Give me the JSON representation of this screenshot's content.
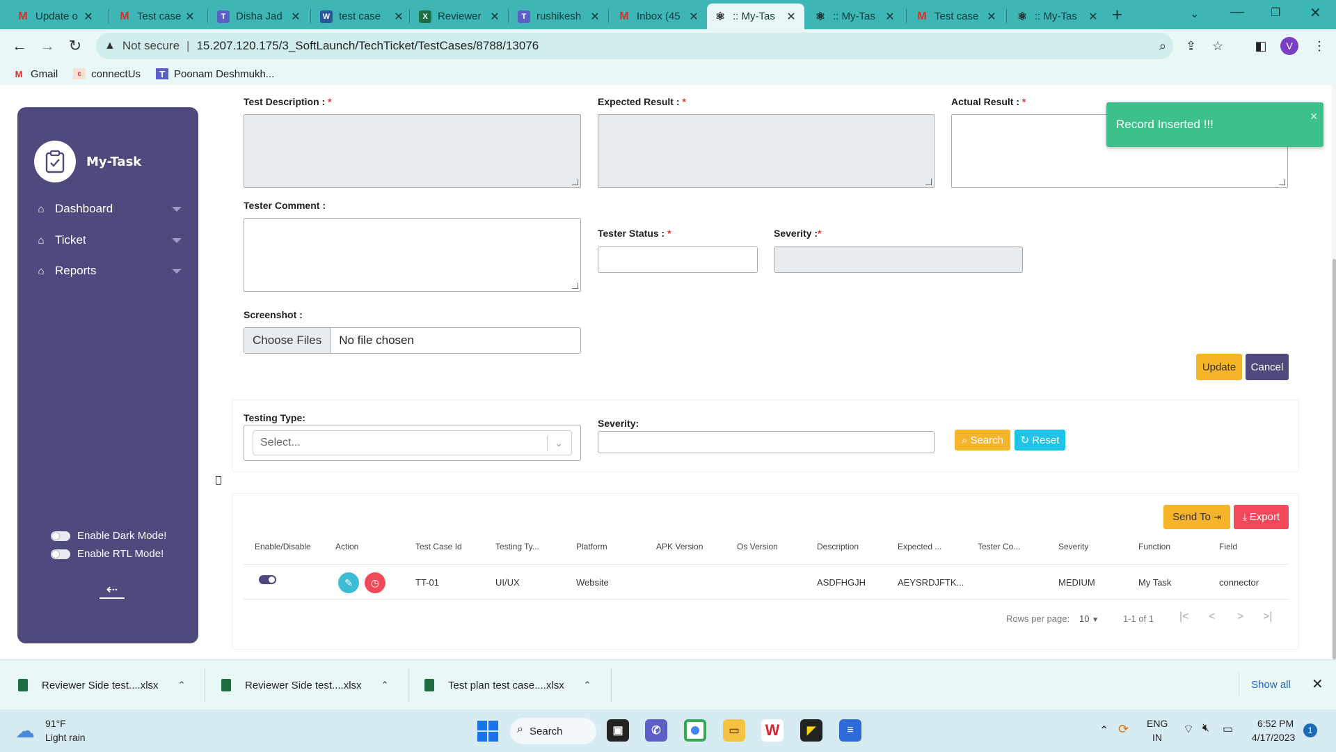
{
  "browser": {
    "tabs": [
      {
        "label": "Update o",
        "icon": "gmail-icon",
        "active": false
      },
      {
        "label": "Test case",
        "icon": "gmail-icon",
        "active": false
      },
      {
        "label": "Disha Jad",
        "icon": "teams-icon",
        "active": false
      },
      {
        "label": "test case",
        "icon": "word-icon",
        "active": false
      },
      {
        "label": "Reviewer",
        "icon": "excel-icon",
        "active": false
      },
      {
        "label": "rushikesh",
        "icon": "teams-icon",
        "active": false
      },
      {
        "label": "Inbox (45",
        "icon": "gmail-icon",
        "active": false
      },
      {
        "label": ":: My-Tas",
        "icon": "react-icon",
        "active": true
      },
      {
        "label": ":: My-Tas",
        "icon": "react-icon",
        "active": false
      },
      {
        "label": "Test case",
        "icon": "gmail-icon",
        "active": false
      },
      {
        "label": ":: My-Tas",
        "icon": "react-icon",
        "active": false
      }
    ],
    "security_label": "Not secure",
    "url": "15.207.120.175/3_SoftLaunch/TechTicket/TestCases/8788/13076",
    "profile_initial": "V",
    "bookmarks": [
      {
        "label": "Gmail",
        "icon": "gmail-icon"
      },
      {
        "label": "connectUs",
        "icon": "connectus-icon"
      },
      {
        "label": "Poonam Deshmukh...",
        "icon": "teams-icon"
      }
    ]
  },
  "sidebar": {
    "app_name": "My-Task",
    "nav": [
      {
        "label": "Dashboard",
        "icon": "home-icon"
      },
      {
        "label": "Ticket",
        "icon": "home-icon"
      },
      {
        "label": "Reports",
        "icon": "home-icon"
      }
    ],
    "dark_mode_label": "Enable Dark Mode!",
    "rtl_mode_label": "Enable RTL Mode!"
  },
  "form": {
    "test_description_label": "Test Description :",
    "expected_result_label": "Expected Result :",
    "actual_result_label": "Actual Result :",
    "tester_comment_label": "Tester Comment :",
    "tester_status_label": "Tester Status :",
    "severity_label": "Severity :",
    "screenshot_label": "Screenshot :",
    "choose_files": "Choose Files",
    "no_file": "No file chosen",
    "required_mark": "*",
    "update_button": "Update",
    "cancel_button": "Cancel"
  },
  "filter": {
    "testing_type_label": "Testing Type:",
    "testing_type_placeholder": "Select...",
    "severity_label": "Severity:",
    "search_button": "Search",
    "reset_button": "Reset"
  },
  "table": {
    "send_to_button": "Send To",
    "export_button": "Export",
    "columns": [
      "Enable/Disable",
      "Action",
      "Test Case Id",
      "Testing Ty...",
      "Platform",
      "APK Version",
      "Os Version",
      "Description",
      "Expected ...",
      "Tester Co...",
      "Severity",
      "Function",
      "Field"
    ],
    "rows": [
      {
        "enabled": true,
        "test_case_id": "TT-01",
        "testing_type": "UI/UX",
        "platform": "Website",
        "apk_version": "",
        "os_version": "",
        "description": "ASDFHGJH",
        "expected": "AEYSRDJFTK...",
        "tester_comment": "",
        "severity": "MEDIUM",
        "function": "My Task",
        "field": "connector"
      }
    ],
    "rows_per_page_label": "Rows per page:",
    "rows_per_page": "10",
    "page_range": "1-1 of 1"
  },
  "toast": {
    "message": "Record Inserted !!!",
    "color": "#3ec08a"
  },
  "downloads": {
    "items": [
      "Reviewer Side test....xlsx",
      "Reviewer Side test....xlsx",
      "Test plan test case....xlsx"
    ],
    "show_all": "Show all"
  },
  "taskbar": {
    "temperature": "91°F",
    "weather": "Light rain",
    "search_label": "Search",
    "language_top": "ENG",
    "language_bottom": "IN",
    "time": "6:52 PM",
    "date": "4/17/2023",
    "notification_count": "1"
  },
  "colors": {
    "sidebar": "#4e4a7e",
    "warning_button": "#f5b42a",
    "danger_button": "#f0495a",
    "info_button": "#1fc3e8"
  }
}
